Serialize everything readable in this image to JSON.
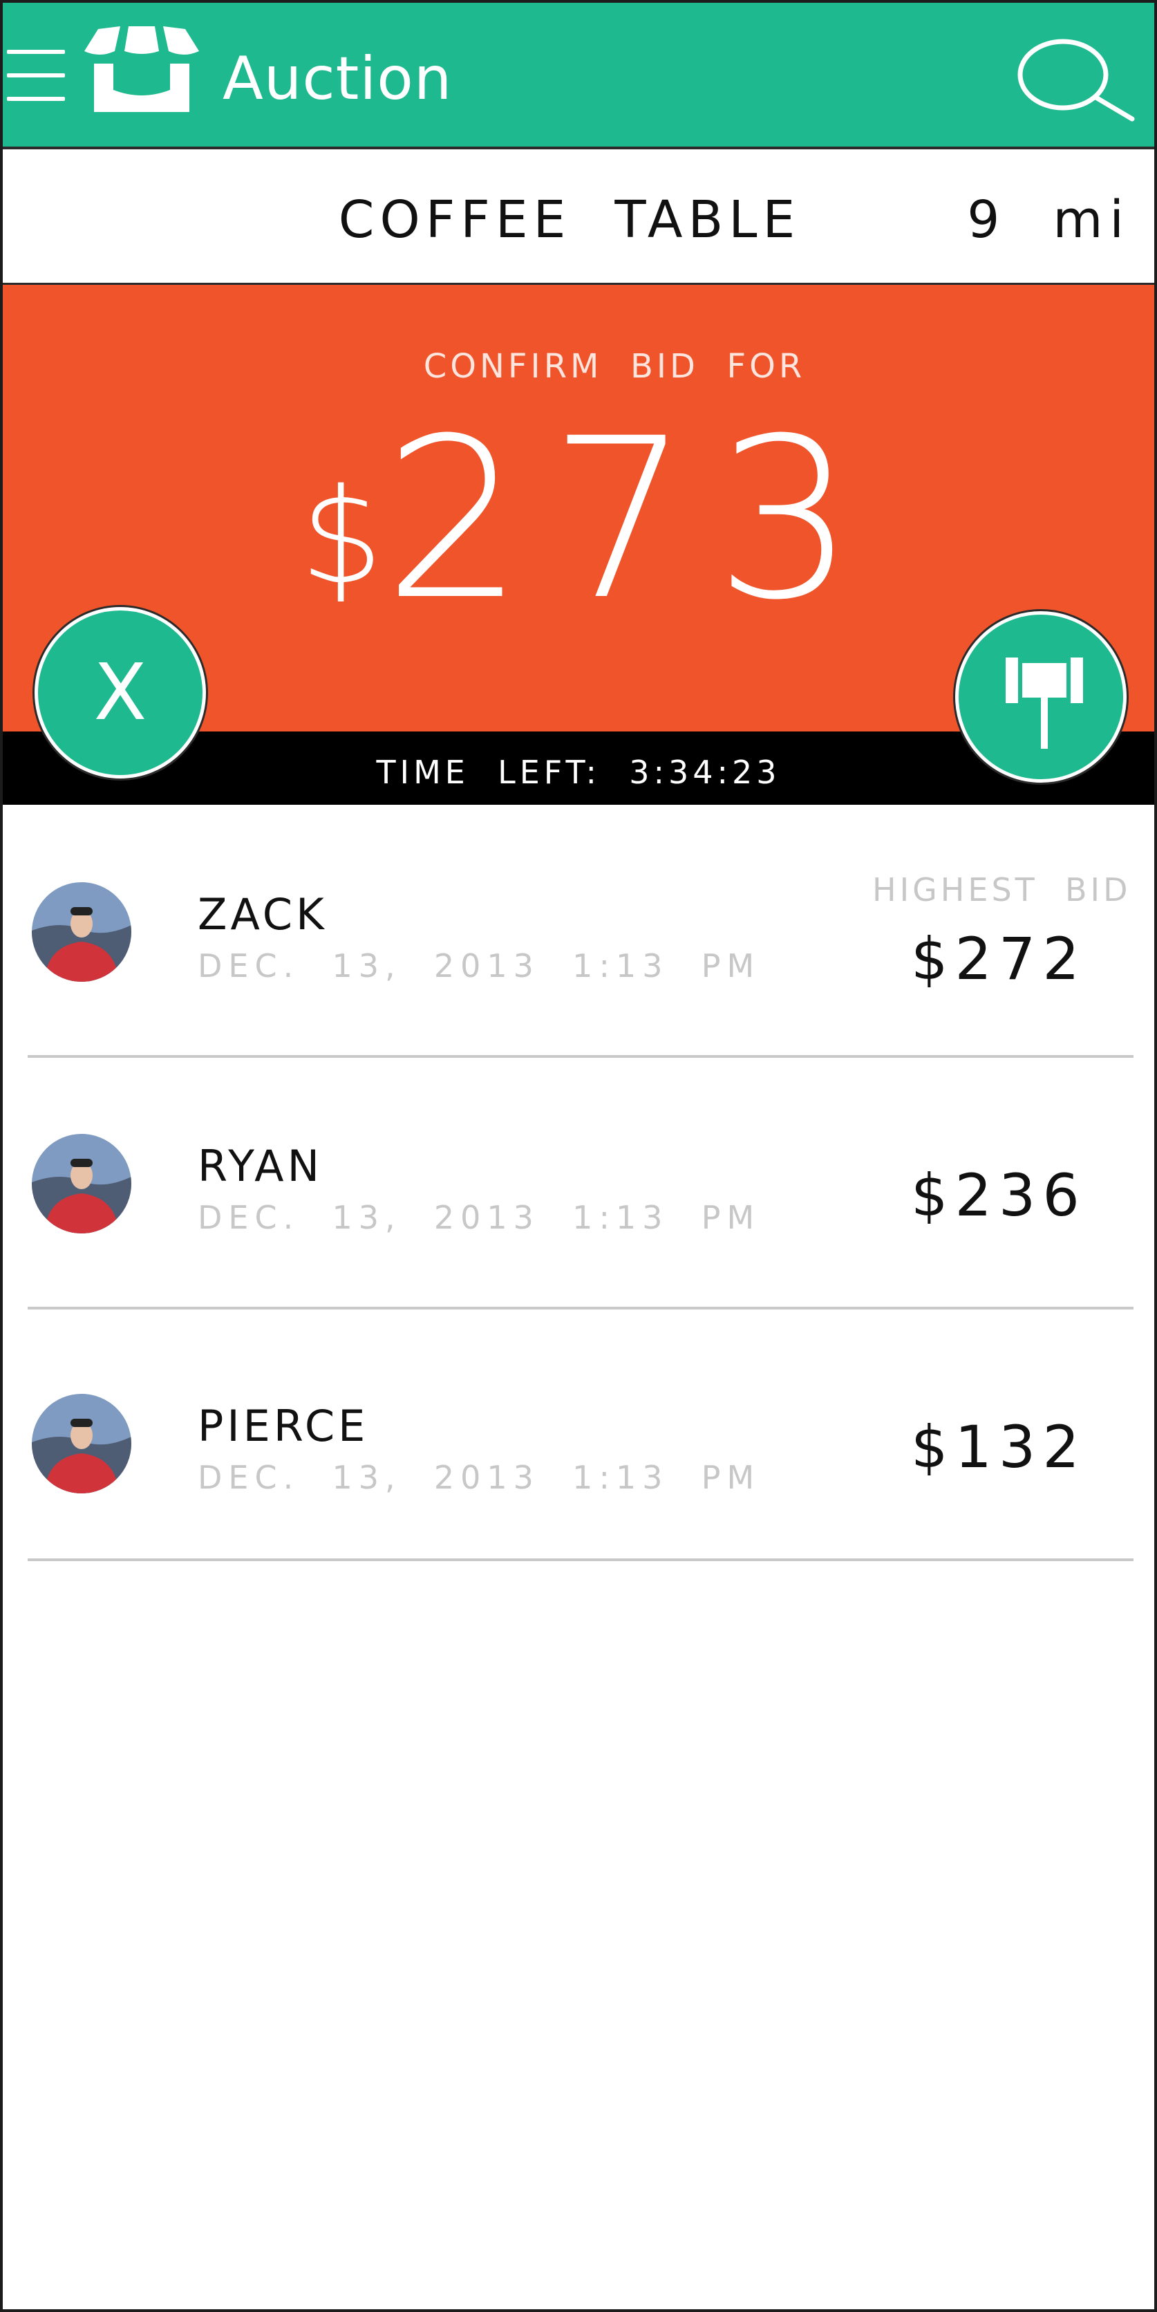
{
  "app": {
    "title": "Auction"
  },
  "item": {
    "name": "COFFEE  TABLE",
    "distance": "9  mi"
  },
  "confirm": {
    "label": "CONFIRM  BID  FOR",
    "currency": "$",
    "amount": "273",
    "cancel_label": "X",
    "time_left": "TIME  LEFT:  3:34:23"
  },
  "bids": {
    "highest_label": "HIGHEST  BID",
    "rows": [
      {
        "name": "ZACK",
        "date": "DEC.  13,  2013  1:13  PM",
        "amount": "$272"
      },
      {
        "name": "RYAN",
        "date": "DEC.  13,  2013  1:13  PM",
        "amount": "$236"
      },
      {
        "name": "PIERCE",
        "date": "DEC.  13,  2013  1:13  PM",
        "amount": "$132"
      }
    ]
  },
  "colors": {
    "primary": "#1fb98f",
    "accent": "#f0542b",
    "timebar": "#000000",
    "muted": "#c7c7c7"
  },
  "icons": [
    "menu-icon",
    "store-icon",
    "search-icon",
    "gavel-icon",
    "avatar"
  ]
}
